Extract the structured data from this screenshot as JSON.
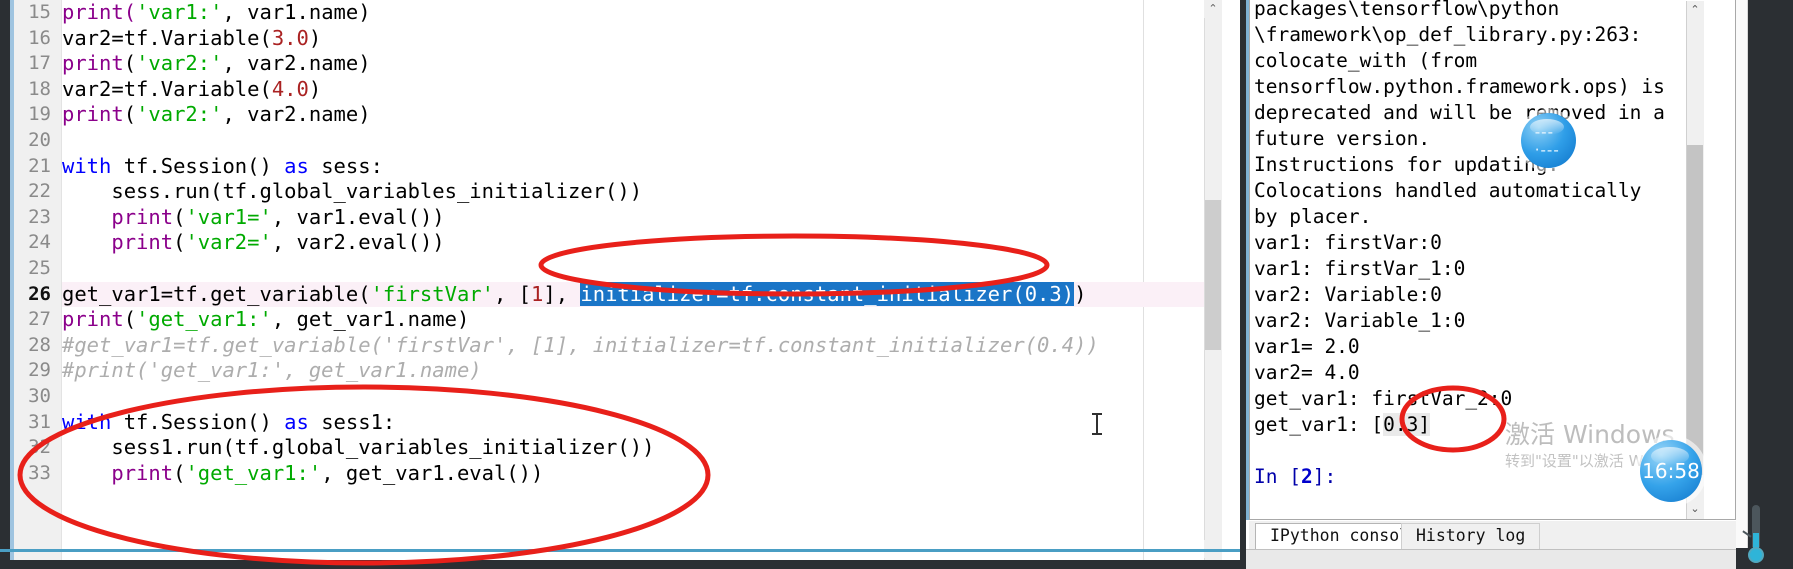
{
  "app": {
    "name": "Spyder IDE"
  },
  "editor": {
    "name": "python-code-editor",
    "lines": [
      {
        "num": "15",
        "tokens": [
          {
            "t": "print(",
            "c": "fn"
          },
          {
            "t": "'var1:'",
            "c": "str"
          },
          {
            "t": ", var1.name)",
            "c": "plain"
          }
        ]
      },
      {
        "num": "16",
        "tokens": [
          {
            "t": "var2=tf.Variable(",
            "c": "plain"
          },
          {
            "t": "3.0",
            "c": "num"
          },
          {
            "t": ")",
            "c": "plain"
          }
        ]
      },
      {
        "num": "17",
        "tokens": [
          {
            "t": "print",
            "c": "fn"
          },
          {
            "t": "(",
            "c": "plain"
          },
          {
            "t": "'var2:'",
            "c": "str"
          },
          {
            "t": ", var2.name)",
            "c": "plain"
          }
        ]
      },
      {
        "num": "18",
        "tokens": [
          {
            "t": "var2=tf.Variable(",
            "c": "plain"
          },
          {
            "t": "4.0",
            "c": "num"
          },
          {
            "t": ")",
            "c": "plain"
          }
        ]
      },
      {
        "num": "19",
        "tokens": [
          {
            "t": "print",
            "c": "fn"
          },
          {
            "t": "(",
            "c": "plain"
          },
          {
            "t": "'var2:'",
            "c": "str"
          },
          {
            "t": ", var2.name)",
            "c": "plain"
          }
        ]
      },
      {
        "num": "20",
        "tokens": []
      },
      {
        "num": "21",
        "tokens": [
          {
            "t": "with",
            "c": "kw"
          },
          {
            "t": " tf.Session() ",
            "c": "plain"
          },
          {
            "t": "as",
            "c": "kw"
          },
          {
            "t": " sess:",
            "c": "plain"
          }
        ]
      },
      {
        "num": "22",
        "tokens": [
          {
            "t": "    sess.run(tf.global_variables_initializer())",
            "c": "plain"
          }
        ]
      },
      {
        "num": "23",
        "tokens": [
          {
            "t": "    ",
            "c": "plain"
          },
          {
            "t": "print",
            "c": "fn"
          },
          {
            "t": "(",
            "c": "plain"
          },
          {
            "t": "'var1='",
            "c": "str"
          },
          {
            "t": ", var1.eval())",
            "c": "plain"
          }
        ]
      },
      {
        "num": "24",
        "tokens": [
          {
            "t": "    ",
            "c": "plain"
          },
          {
            "t": "print",
            "c": "fn"
          },
          {
            "t": "(",
            "c": "plain"
          },
          {
            "t": "'var2='",
            "c": "str"
          },
          {
            "t": ", var2.eval())",
            "c": "plain"
          }
        ]
      },
      {
        "num": "25",
        "tokens": []
      },
      {
        "num": "26",
        "current": true,
        "tokens": [
          {
            "t": "get_var1=tf.get_variable(",
            "c": "plain"
          },
          {
            "t": "'firstVar'",
            "c": "str"
          },
          {
            "t": ", [",
            "c": "plain"
          },
          {
            "t": "1",
            "c": "num"
          },
          {
            "t": "], ",
            "c": "plain"
          },
          {
            "t": "initializer=tf.constant_initializer(0.3)",
            "c": "sel"
          },
          {
            "t": ")",
            "c": "plain"
          }
        ]
      },
      {
        "num": "27",
        "tokens": [
          {
            "t": "print",
            "c": "fn"
          },
          {
            "t": "(",
            "c": "plain"
          },
          {
            "t": "'get_var1:'",
            "c": "str"
          },
          {
            "t": ", get_var1.name)",
            "c": "plain"
          }
        ]
      },
      {
        "num": "28",
        "tokens": [
          {
            "t": "#get_var1=tf.get_variable('firstVar', [1], initializer=tf.constant_initializer(0.4))",
            "c": "cmt"
          }
        ]
      },
      {
        "num": "29",
        "tokens": [
          {
            "t": "#print('get_var1:', get_var1.name)",
            "c": "cmt"
          }
        ]
      },
      {
        "num": "30",
        "tokens": []
      },
      {
        "num": "31",
        "tokens": [
          {
            "t": "with",
            "c": "kw"
          },
          {
            "t": " tf.Session() ",
            "c": "plain"
          },
          {
            "t": "as",
            "c": "kw"
          },
          {
            "t": " sess1:",
            "c": "plain"
          }
        ]
      },
      {
        "num": "32",
        "tokens": [
          {
            "t": "    sess1.run(tf.global_variables_initializer())",
            "c": "plain"
          }
        ]
      },
      {
        "num": "33",
        "tokens": [
          {
            "t": "    ",
            "c": "plain"
          },
          {
            "t": "print",
            "c": "fn"
          },
          {
            "t": "(",
            "c": "plain"
          },
          {
            "t": "'get_var1:'",
            "c": "str"
          },
          {
            "t": ", get_var1.eval())",
            "c": "plain"
          }
        ]
      }
    ],
    "selected_text": "initializer=tf.constant_initializer(0.3)",
    "colors": {
      "keyword": "#0000ff",
      "function": "#8b008b",
      "string": "#00aa00",
      "number": "#aa2222",
      "comment": "#adadad",
      "selection_bg": "#1a75c7",
      "current_line_bg": "#fbf0f7"
    }
  },
  "console": {
    "name": "ipython-console",
    "lines": [
      {
        "text": "packages\\tensorflow\\python"
      },
      {
        "text": "\\framework\\op_def_library.py:263:"
      },
      {
        "text": "colocate_with (from"
      },
      {
        "text": "tensorflow.python.framework.ops) is"
      },
      {
        "text": "deprecated and will be removed in a"
      },
      {
        "text": "future version."
      },
      {
        "text": "Instructions for updating:"
      },
      {
        "text": "Colocations handled automatically"
      },
      {
        "text": "by placer."
      },
      {
        "text": "var1: firstVar:0"
      },
      {
        "text": "var1: firstVar_1:0"
      },
      {
        "text": "var2: Variable:0"
      },
      {
        "text": "var2: Variable_1:0"
      },
      {
        "text": "var1= 2.0"
      },
      {
        "text": "var2= 4.0"
      },
      {
        "text": "get_var1: firstVar_2:0"
      },
      {
        "text": "get_var1: [0.3]",
        "highlight": true
      },
      {
        "text": ""
      }
    ],
    "prompt": {
      "prefix": "In [",
      "number": "2",
      "suffix": "]:"
    },
    "tabs": [
      {
        "label": "IPython console",
        "active": true
      },
      {
        "label": "History log",
        "active": false
      }
    ]
  },
  "annotations": {
    "ellipse_1_target": "initializer=tf.constant_initializer(0.3)",
    "ellipse_2_target": "with tf.Session() as sess1 block",
    "ellipse_3_target": "get_var1: [0.3]",
    "color": "#e8201a"
  },
  "widgets": {
    "clock": {
      "name": "desktop-clock-widget",
      "time": "16:58"
    },
    "dashes": {
      "name": "desktop-blue-widget",
      "text": "---·---"
    },
    "thermometer": {
      "name": "desktop-thermometer-widget"
    }
  },
  "watermark": {
    "line1": "激活 Windows",
    "line2": "转到\"设置\"以激活 Windows。"
  },
  "scrollbars": {
    "editor_up": "⌃",
    "editor_down": "⌄",
    "console_up": "⌃",
    "console_down": "⌄"
  }
}
